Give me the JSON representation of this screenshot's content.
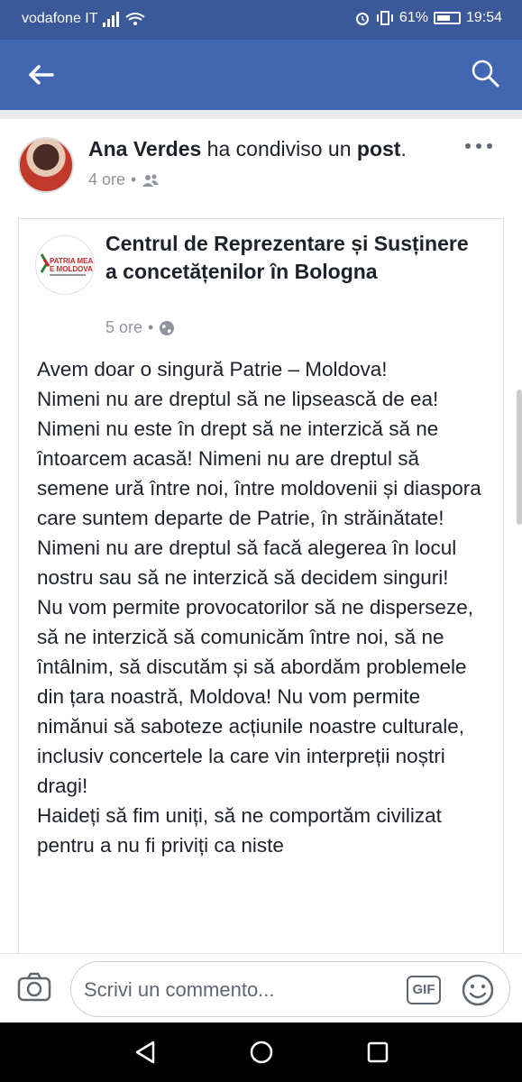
{
  "status_bar": {
    "carrier": "vodafone IT",
    "battery": "61%",
    "time": "19:54"
  },
  "app_bar": {
    "back_icon": "arrow-left-icon",
    "search_icon": "search-icon"
  },
  "post": {
    "author": "Ana Verdes",
    "action_text": " ha condiviso un ",
    "object_text": "post",
    "time_ago": "4 ore",
    "audience_icon": "friends-icon",
    "shared": {
      "page_name": "Centrul de Reprezentare și Susținere a concetățenilor în Bologna",
      "logo_line1": "PATRIA MEA",
      "logo_line2": "E MOLDOVA",
      "time_ago": "5 ore",
      "audience_icon": "globe-icon",
      "body": "Avem doar o singură Patrie – Moldova!\nNimeni nu are dreptul să ne lipsească de ea! Nimeni nu este în drept să ne interzică să ne întoarcem acasă! Nimeni nu are dreptul să semene ură între noi, între moldovenii și diaspora care suntem departe de Patrie, în străinătate!\nNimeni nu are dreptul să facă alegerea în locul nostru sau să ne interzică să decidem singuri!\nNu vom permite provocatorilor să ne disperseze, să ne interzică să comunicăm între noi, să ne întâlnim, să discutăm și să abordăm problemele din țara noastră, Moldova! Nu vom permite nimănui să saboteze acțiunile noastre culturale, inclusiv concertele la care vin interpreții noștri dragi!\nHaideți să fim uniți, să ne comportăm civilizat pentru a nu fi priviți ca niste"
    }
  },
  "comment_bar": {
    "placeholder": "Scrivi un commento...",
    "gif_label": "GIF"
  },
  "colors": {
    "brand": "#4267b2",
    "status_bar": "#3b5998"
  }
}
